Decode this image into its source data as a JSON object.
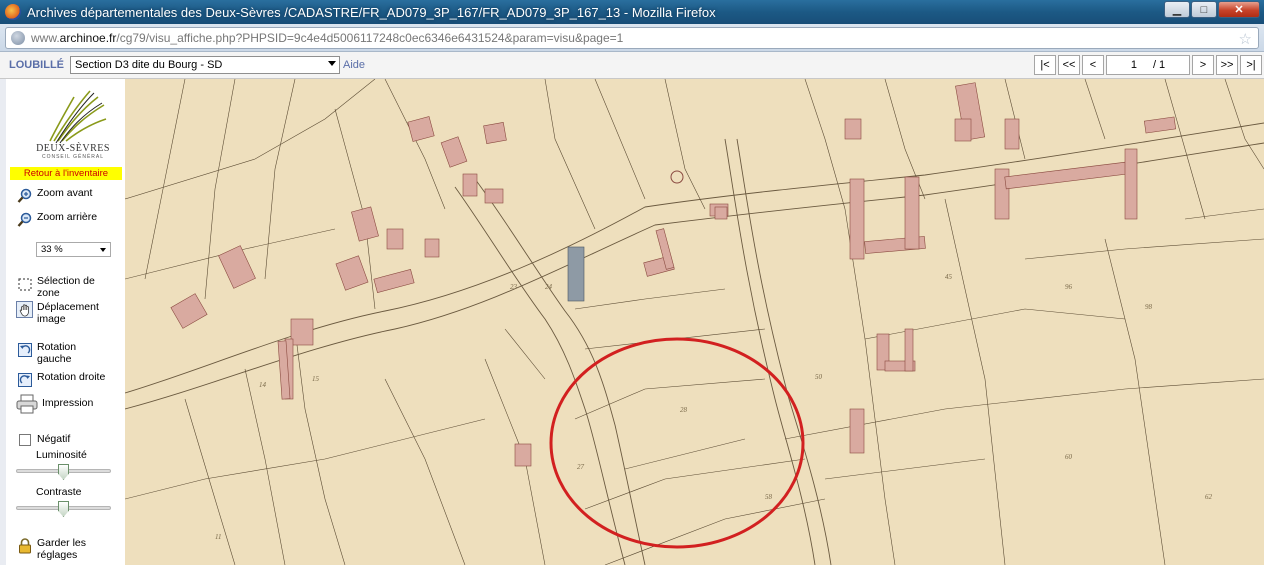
{
  "window": {
    "title": "Archives départementales des Deux-Sèvres /CADASTRE/FR_AD079_3P_167/FR_AD079_3P_167_13 - Mozilla Firefox",
    "minimize": "▁",
    "maximize": "□",
    "close": "✕"
  },
  "urlbar": {
    "prefix": "www.",
    "domain": "archinoe.fr",
    "path": "/cg79/visu_affiche.php?PHPSID=9c4e4d5006117248c0ec6346e6431524&param=visu&page=1"
  },
  "toolbar": {
    "commune": "LOUBILLÉ",
    "section": "Section D3 dite du Bourg - SD",
    "help": "Aide",
    "pager": {
      "first": "|<",
      "prev_many": "<<",
      "prev": "<",
      "current_page": "1",
      "total": "/ 1",
      "next": ">",
      "next_many": ">>",
      "last": ">|"
    }
  },
  "sidebar": {
    "logo_title": "DEUX-SÈVRES",
    "logo_subtitle": "CONSEIL GÉNÉRAL",
    "back_link": "Retour à l'inventaire",
    "zoom_in": "Zoom avant",
    "zoom_out": "Zoom arrière",
    "zoom_level": "33 %",
    "select_zone": "Sélection de zone",
    "pan_image": "Déplacement image",
    "rotate_left": "Rotation gauche",
    "rotate_right": "Rotation droite",
    "print": "Impression",
    "negative": "Négatif",
    "brightness": "Luminosité",
    "contrast": "Contraste",
    "keep_settings": "Garder les réglages",
    "brightness_value": 0.5,
    "contrast_value": 0.5
  },
  "map": {
    "paper_color": "#f1e2c2",
    "building_color": "#d9aaa0",
    "annotation_color": "#d22020"
  }
}
